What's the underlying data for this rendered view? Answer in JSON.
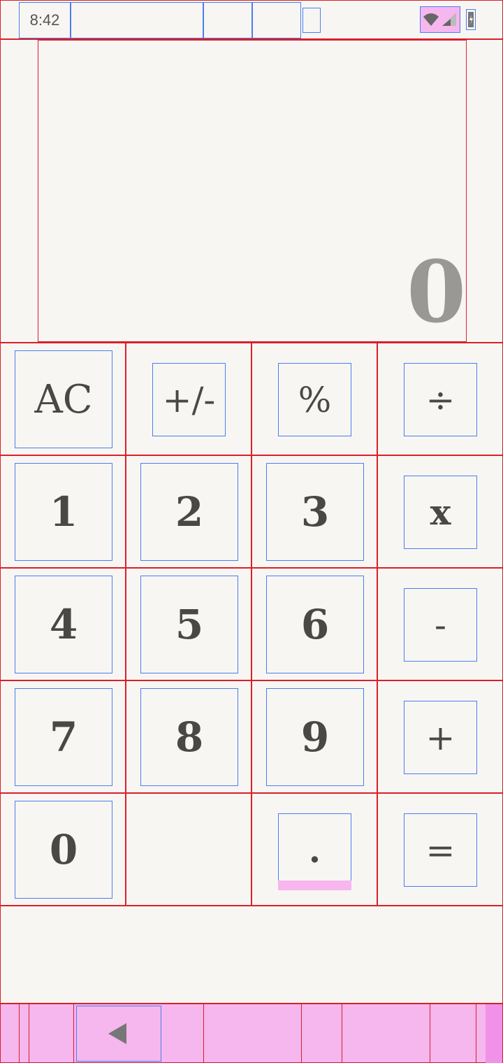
{
  "status_bar": {
    "time": "8:42",
    "icons": [
      "wifi-icon",
      "signal-icon",
      "battery-icon"
    ]
  },
  "display": {
    "value": "0"
  },
  "keypad": {
    "row1": [
      "AC",
      "+/-",
      "%",
      "÷"
    ],
    "row2": [
      "1",
      "2",
      "3",
      "x"
    ],
    "row3": [
      "4",
      "5",
      "6",
      "-"
    ],
    "row4": [
      "7",
      "8",
      "9",
      "+"
    ],
    "row5": [
      "0",
      "",
      ".",
      "="
    ]
  },
  "nav_bar": {
    "back_icon": "back-triangle-icon"
  },
  "colors": {
    "background": "#f8f6f3",
    "display_text": "#9a9895",
    "key_text": "#4a4845"
  }
}
